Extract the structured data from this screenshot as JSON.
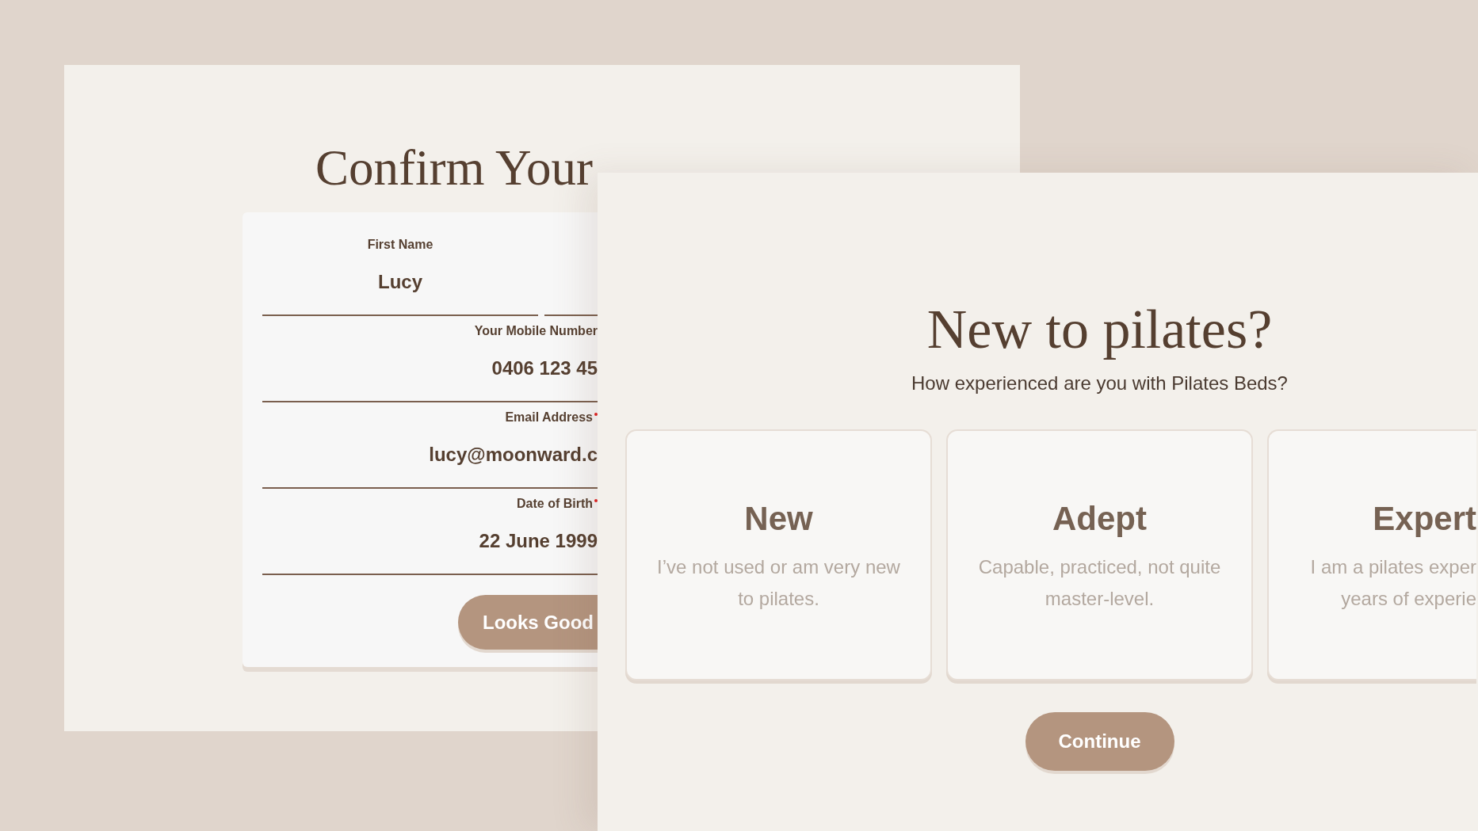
{
  "back_screen": {
    "title": "Confirm Your",
    "fields": [
      {
        "kind": "half",
        "label": "First Name",
        "value": "Lucy",
        "required": false
      },
      {
        "kind": "full",
        "label": "Your Mobile Number",
        "value": "0406 123 45",
        "required": false
      },
      {
        "kind": "full",
        "label": "Email Address",
        "value": "lucy@moonward.c",
        "required": true
      },
      {
        "kind": "full",
        "label": "Date of Birth",
        "value": "22 June 1999",
        "required": true
      }
    ],
    "button": "Looks Good"
  },
  "front_screen": {
    "title": "New to pilates?",
    "subtitle": "How experienced are you with Pilates Beds?",
    "options": [
      {
        "title": "New",
        "lines": [
          "I’ve not used or am very new",
          "to pilates."
        ],
        "clipped": false
      },
      {
        "title": "Adept",
        "lines": [
          "Capable, practiced, not quite",
          "master-level."
        ],
        "clipped": false
      },
      {
        "title": "Expert",
        "lines": [
          "I am a pilates exper",
          "years of experie"
        ],
        "clipped": true
      }
    ],
    "button": "Continue"
  }
}
